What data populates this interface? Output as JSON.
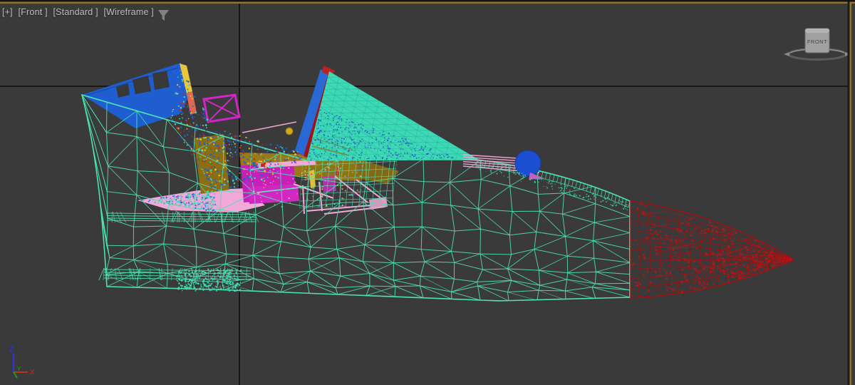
{
  "viewport": {
    "menu_general": "[+]",
    "menu_view": "[Front ]",
    "menu_render_preset": "[Standard ]",
    "menu_shading": "[Wireframe ]"
  },
  "viewcube": {
    "face_label": "FRONT"
  },
  "axis_tripod": {
    "x_label": "X",
    "y_label": "Y",
    "z_label": "Z"
  },
  "colors": {
    "background": "#3a3a3a",
    "active_border_gold": "#8d7733",
    "grid_origin_line": "#181818",
    "wireframe_teal": "#4ce2b2",
    "canopy_teal": "#3dd8b5",
    "canopy_dot_blue": "#2a52cc",
    "fin_blue": "#1e5ed0",
    "windshield_red": "#a01218",
    "nose_cone_red": "#a81010",
    "detail_magenta": "#cc22c4",
    "detail_pink": "#f2a8d4",
    "detail_olive": "#8f7414",
    "detail_yellow": "#e6c63c",
    "axis_x_red": "#c03028",
    "axis_y_green": "#18a018",
    "axis_z_blue": "#2a35e0"
  }
}
